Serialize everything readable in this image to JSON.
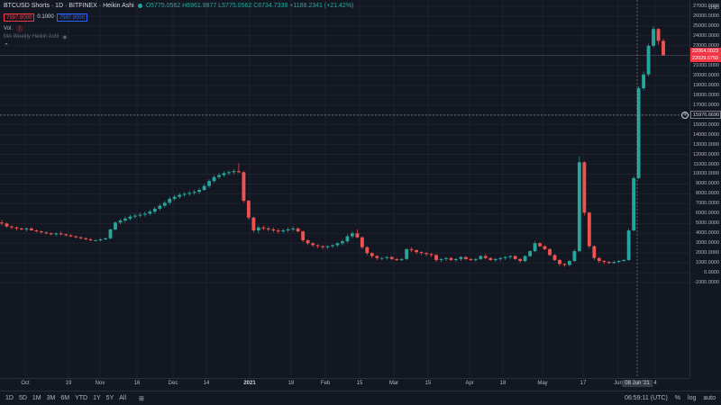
{
  "legend": {
    "symbol": "BTCUSD Shorts · 1D · BITFINEX · Heikin Ashi",
    "ohlc": "O5775.0562 H6961.9877 L5775.0562 C6734.7338 +1188.2341 (+21.42%)",
    "status_color": "#26a69a"
  },
  "price_boxes": {
    "bid": "7597.8000",
    "spread": "0.1000",
    "ask": "7597.9000"
  },
  "indicators": {
    "vol": "Vol.",
    "vol_warning": "!",
    "ma": "MA Weekly Heikin Ashi"
  },
  "price_axis": {
    "currency": "USD",
    "ticks": [
      "27000.0000",
      "26000.0000",
      "25000.0000",
      "24000.0000",
      "23000.0000",
      "22000.0000",
      "21000.0000",
      "20000.0000",
      "19000.0000",
      "18000.0000",
      "17000.0000",
      "16000.0000",
      "15000.0000",
      "14000.0000",
      "13000.0000",
      "12000.0000",
      "11000.0000",
      "10000.0000",
      "9000.0000",
      "8000.0000",
      "7000.0000",
      "6000.0000",
      "5000.0000",
      "4000.0000",
      "3000.0000",
      "2000.0000",
      "1000.0000",
      "0.0000",
      "-1000.0000"
    ],
    "last_high": "22064.0023",
    "last_close": "22029.6750",
    "crosshair_price": "15976.6690"
  },
  "time_axis": {
    "labels": [
      "Oct",
      "19",
      "Nov",
      "16",
      "Dec",
      "14",
      "2021",
      "18",
      "Feb",
      "15",
      "Mar",
      "15",
      "Apr",
      "18",
      "May",
      "17",
      "Jun",
      "4"
    ],
    "crosshair_date": "08 Jun '21"
  },
  "bottom_bar": {
    "timeframes": [
      "1D",
      "5D",
      "1M",
      "3M",
      "6M",
      "YTD",
      "1Y",
      "5Y",
      "All"
    ],
    "clock": "06:59:11 (UTC)",
    "percent": "%",
    "log": "log",
    "auto": "auto"
  },
  "colors": {
    "up": "#26a69a",
    "down": "#ef5350",
    "background": "#131722",
    "grid": "#1e222d"
  },
  "chart_data": {
    "type": "candlestick",
    "ylim": [
      -1500,
      27500
    ],
    "up_color": "#26a69a",
    "down_color": "#ef5350",
    "candles": [
      [
        5100,
        5400,
        4800,
        5000
      ],
      [
        5000,
        5100,
        4600,
        4700
      ],
      [
        4700,
        4800,
        4400,
        4600
      ],
      [
        4600,
        4700,
        4300,
        4500
      ],
      [
        4500,
        4600,
        4300,
        4400
      ],
      [
        4400,
        4600,
        4200,
        4500
      ],
      [
        4500,
        4600,
        4300,
        4300
      ],
      [
        4300,
        4400,
        4100,
        4200
      ],
      [
        4200,
        4300,
        4000,
        4100
      ],
      [
        4100,
        4200,
        3900,
        4000
      ],
      [
        4000,
        4100,
        3800,
        3900
      ],
      [
        3900,
        4100,
        3700,
        4000
      ],
      [
        4000,
        4200,
        3800,
        3900
      ],
      [
        3900,
        4000,
        3700,
        3800
      ],
      [
        3800,
        3900,
        3600,
        3700
      ],
      [
        3700,
        3800,
        3500,
        3600
      ],
      [
        3600,
        3700,
        3400,
        3500
      ],
      [
        3500,
        3600,
        3300,
        3400
      ],
      [
        3400,
        3500,
        3200,
        3300
      ],
      [
        3300,
        3400,
        3200,
        3300
      ],
      [
        3300,
        3500,
        3200,
        3400
      ],
      [
        3400,
        3600,
        3300,
        3500
      ],
      [
        3500,
        4500,
        3400,
        4400
      ],
      [
        4400,
        5200,
        4300,
        5100
      ],
      [
        5100,
        5500,
        4900,
        5300
      ],
      [
        5300,
        5700,
        5100,
        5500
      ],
      [
        5500,
        5900,
        5300,
        5700
      ],
      [
        5700,
        6000,
        5500,
        5800
      ],
      [
        5800,
        6100,
        5600,
        5900
      ],
      [
        5900,
        6200,
        5700,
        6000
      ],
      [
        6000,
        6400,
        5800,
        6200
      ],
      [
        6200,
        6700,
        6000,
        6500
      ],
      [
        6500,
        7000,
        6300,
        6800
      ],
      [
        6800,
        7300,
        6600,
        7100
      ],
      [
        7100,
        7700,
        6900,
        7500
      ],
      [
        7500,
        7900,
        7300,
        7700
      ],
      [
        7700,
        8100,
        7500,
        7900
      ],
      [
        7900,
        8200,
        7700,
        8000
      ],
      [
        8000,
        8300,
        7800,
        8100
      ],
      [
        8100,
        8400,
        7900,
        8200
      ],
      [
        8200,
        8600,
        8000,
        8400
      ],
      [
        8400,
        9000,
        8300,
        8800
      ],
      [
        8800,
        9500,
        8600,
        9300
      ],
      [
        9300,
        9900,
        9100,
        9700
      ],
      [
        9700,
        10100,
        9500,
        9900
      ],
      [
        9900,
        10300,
        9700,
        10100
      ],
      [
        10100,
        10400,
        9900,
        10200
      ],
      [
        10200,
        10500,
        10000,
        10300
      ],
      [
        10300,
        11100,
        10100,
        10200
      ],
      [
        10200,
        10300,
        7100,
        7300
      ],
      [
        7300,
        7400,
        5400,
        5600
      ],
      [
        5600,
        5700,
        4100,
        4300
      ],
      [
        4300,
        4800,
        4000,
        4600
      ],
      [
        4600,
        4800,
        4300,
        4500
      ],
      [
        4500,
        4700,
        4200,
        4400
      ],
      [
        4400,
        4600,
        4100,
        4300
      ],
      [
        4300,
        4500,
        4000,
        4200
      ],
      [
        4200,
        4500,
        4000,
        4300
      ],
      [
        4300,
        4600,
        4100,
        4400
      ],
      [
        4400,
        4700,
        4200,
        4500
      ],
      [
        4500,
        4600,
        4100,
        4200
      ],
      [
        4200,
        4300,
        3100,
        3300
      ],
      [
        3300,
        3400,
        2800,
        3000
      ],
      [
        3000,
        3100,
        2600,
        2800
      ],
      [
        2800,
        2900,
        2500,
        2700
      ],
      [
        2700,
        2800,
        2400,
        2600
      ],
      [
        2600,
        2800,
        2400,
        2700
      ],
      [
        2700,
        2900,
        2500,
        2800
      ],
      [
        2800,
        3100,
        2600,
        3000
      ],
      [
        3000,
        3400,
        2800,
        3200
      ],
      [
        3200,
        3900,
        3000,
        3700
      ],
      [
        3700,
        4200,
        3500,
        4000
      ],
      [
        4000,
        4400,
        3500,
        3600
      ],
      [
        3600,
        3700,
        2400,
        2600
      ],
      [
        2600,
        2700,
        1800,
        2000
      ],
      [
        2000,
        2100,
        1500,
        1700
      ],
      [
        1700,
        1800,
        1300,
        1500
      ],
      [
        1500,
        1600,
        1300,
        1500
      ],
      [
        1500,
        1700,
        1300,
        1600
      ],
      [
        1600,
        1700,
        1300,
        1400
      ],
      [
        1400,
        1500,
        1200,
        1300
      ],
      [
        1300,
        1500,
        1200,
        1400
      ],
      [
        1400,
        2500,
        1300,
        2400
      ],
      [
        2400,
        2600,
        2100,
        2300
      ],
      [
        2300,
        2400,
        1900,
        2100
      ],
      [
        2100,
        2200,
        1800,
        2000
      ],
      [
        2000,
        2100,
        1700,
        1900
      ],
      [
        1900,
        2000,
        1600,
        1800
      ],
      [
        1800,
        1900,
        1100,
        1300
      ],
      [
        1300,
        1500,
        1100,
        1400
      ],
      [
        1400,
        1600,
        1200,
        1500
      ],
      [
        1500,
        1600,
        1200,
        1300
      ],
      [
        1300,
        1500,
        1100,
        1400
      ],
      [
        1400,
        1700,
        1200,
        1600
      ],
      [
        1600,
        1700,
        1300,
        1400
      ],
      [
        1400,
        1500,
        1200,
        1300
      ],
      [
        1300,
        1500,
        1100,
        1400
      ],
      [
        1400,
        1800,
        1300,
        1700
      ],
      [
        1700,
        1900,
        1400,
        1500
      ],
      [
        1500,
        1600,
        1200,
        1300
      ],
      [
        1300,
        1500,
        1100,
        1400
      ],
      [
        1400,
        1600,
        1200,
        1500
      ],
      [
        1500,
        1700,
        1300,
        1600
      ],
      [
        1600,
        1800,
        1400,
        1700
      ],
      [
        1700,
        1800,
        1300,
        1400
      ],
      [
        1400,
        1500,
        1000,
        1200
      ],
      [
        1200,
        1800,
        1100,
        1700
      ],
      [
        1700,
        2300,
        1600,
        2200
      ],
      [
        2200,
        3200,
        2100,
        3000
      ],
      [
        3000,
        3100,
        2600,
        2700
      ],
      [
        2700,
        2800,
        2300,
        2400
      ],
      [
        2400,
        2500,
        1700,
        1800
      ],
      [
        1800,
        1900,
        1200,
        1300
      ],
      [
        1300,
        1400,
        700,
        900
      ],
      [
        900,
        1000,
        600,
        800
      ],
      [
        800,
        1300,
        700,
        1200
      ],
      [
        1200,
        2400,
        1100,
        2200
      ],
      [
        2200,
        11800,
        2100,
        11200
      ],
      [
        11200,
        11300,
        5800,
        6100
      ],
      [
        6100,
        6200,
        2500,
        2700
      ],
      [
        2700,
        2800,
        1300,
        1500
      ],
      [
        1500,
        1600,
        1000,
        1200
      ],
      [
        1200,
        1300,
        900,
        1100
      ],
      [
        1100,
        1200,
        900,
        1000
      ],
      [
        1000,
        1200,
        900,
        1100
      ],
      [
        1100,
        1300,
        1000,
        1200
      ],
      [
        1200,
        1400,
        1100,
        1300
      ],
      [
        1300,
        4500,
        1200,
        4300
      ],
      [
        4300,
        9800,
        4200,
        9600
      ],
      [
        9600,
        18900,
        9500,
        18700
      ],
      [
        18700,
        20400,
        18500,
        20100
      ],
      [
        20100,
        23200,
        19900,
        23000
      ],
      [
        23000,
        25000,
        22800,
        24700
      ],
      [
        24700,
        24800,
        23100,
        23500
      ],
      [
        23500,
        23700,
        22000,
        22030
      ]
    ]
  }
}
